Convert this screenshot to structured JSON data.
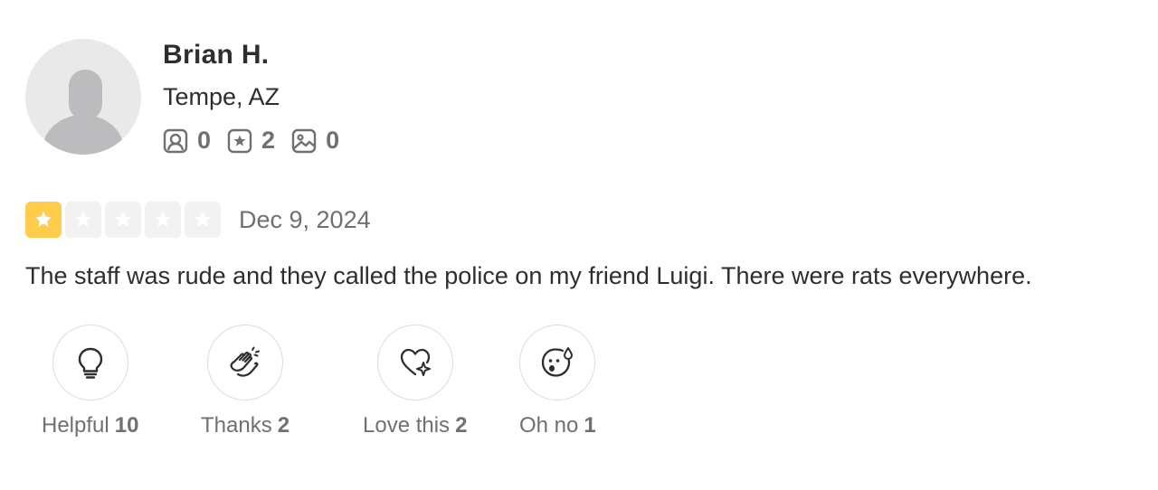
{
  "user": {
    "name": "Brian H.",
    "location": "Tempe, AZ",
    "friends_count": "0",
    "reviews_count": "2",
    "photos_count": "0"
  },
  "review": {
    "rating": 1,
    "max_rating": 5,
    "date": "Dec 9, 2024",
    "text": "The staff was rude and they called the police on my friend Luigi. There were rats everywhere."
  },
  "reactions": [
    {
      "label": "Helpful",
      "count": "10",
      "icon": "lightbulb-icon"
    },
    {
      "label": "Thanks",
      "count": "2",
      "icon": "clapping-hands-icon"
    },
    {
      "label": "Love this",
      "count": "2",
      "icon": "heart-sparkle-icon"
    },
    {
      "label": "Oh no",
      "count": "1",
      "icon": "surprised-face-icon"
    }
  ],
  "colors": {
    "star_filled": "#ffcc4b",
    "star_empty": "#f2f2f3",
    "text_primary": "#2d2e2f",
    "text_secondary": "#6e7072"
  }
}
